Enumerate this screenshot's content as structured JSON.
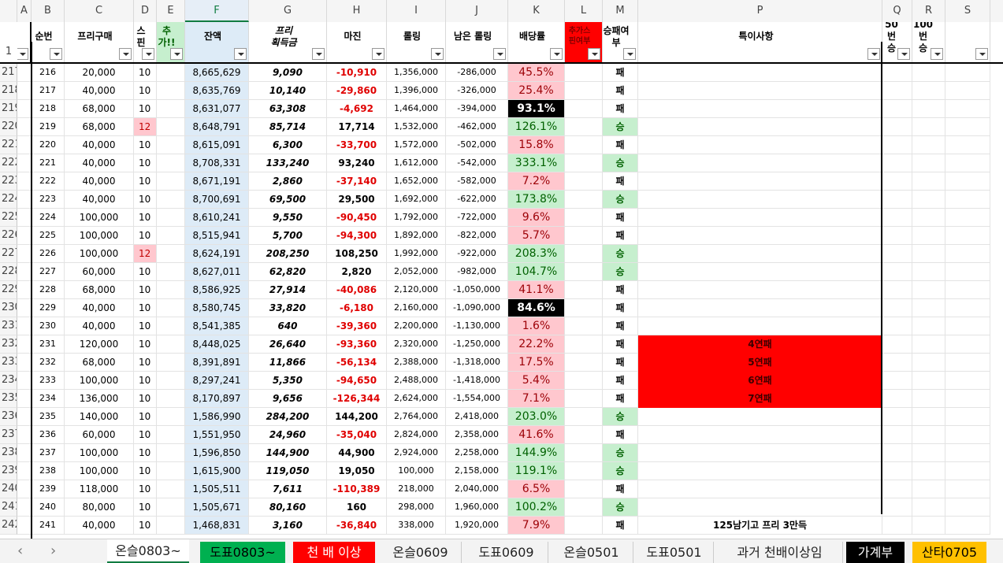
{
  "colors": {
    "pink": "#ffc7ce",
    "green_fill": "#c6efce",
    "green_text": "#006100",
    "red": "#ff0000",
    "blue_col": "#ddebf7",
    "black": "#000000"
  },
  "column_letters": [
    "A",
    "B",
    "C",
    "D",
    "E",
    "F",
    "G",
    "H",
    "I",
    "J",
    "K",
    "L",
    "M",
    "P",
    "Q",
    "R",
    "S"
  ],
  "header_row_number": "1",
  "headers": {
    "B": "순번",
    "C": "프리구매",
    "D": "스핀",
    "E": "추가!!",
    "F": "잔액",
    "G": "프리\n획득금",
    "H": "마진",
    "I": "롤링",
    "J": "남은 롤링",
    "K": "배당률",
    "L": "추가스\n핀여부",
    "M": "승패여\n부",
    "P": "특이사항",
    "Q": "50번\n승",
    "R": "100번\n승"
  },
  "rows": [
    {
      "n": "217",
      "b": "216",
      "c": "20,000",
      "d": "10",
      "f": "8,665,629",
      "g": "9,090",
      "h": "-10,910",
      "i": "1,356,000",
      "j": "-286,000",
      "k": "45.5%",
      "m": "패",
      "p": "",
      "kstyle": "pink"
    },
    {
      "n": "218",
      "b": "217",
      "c": "40,000",
      "d": "10",
      "f": "8,635,769",
      "g": "10,140",
      "h": "-29,860",
      "i": "1,396,000",
      "j": "-326,000",
      "k": "25.4%",
      "m": "패",
      "p": "",
      "kstyle": "pink"
    },
    {
      "n": "219",
      "b": "218",
      "c": "68,000",
      "d": "10",
      "f": "8,631,077",
      "g": "63,308",
      "h": "-4,692",
      "i": "1,464,000",
      "j": "-394,000",
      "k": "93.1%",
      "m": "패",
      "p": "",
      "kstyle": "black"
    },
    {
      "n": "220",
      "b": "219",
      "c": "68,000",
      "d": "12",
      "f": "8,648,791",
      "g": "85,714",
      "h": "17,714",
      "i": "1,532,000",
      "j": "-462,000",
      "k": "126.1%",
      "m": "승",
      "p": "",
      "kstyle": "green",
      "dpink": true
    },
    {
      "n": "221",
      "b": "220",
      "c": "40,000",
      "d": "10",
      "f": "8,615,091",
      "g": "6,300",
      "h": "-33,700",
      "i": "1,572,000",
      "j": "-502,000",
      "k": "15.8%",
      "m": "패",
      "p": "",
      "kstyle": "pink"
    },
    {
      "n": "222",
      "b": "221",
      "c": "40,000",
      "d": "10",
      "f": "8,708,331",
      "g": "133,240",
      "h": "93,240",
      "i": "1,612,000",
      "j": "-542,000",
      "k": "333.1%",
      "m": "승",
      "p": "",
      "kstyle": "green"
    },
    {
      "n": "223",
      "b": "222",
      "c": "40,000",
      "d": "10",
      "f": "8,671,191",
      "g": "2,860",
      "h": "-37,140",
      "i": "1,652,000",
      "j": "-582,000",
      "k": "7.2%",
      "m": "패",
      "p": "",
      "kstyle": "pink"
    },
    {
      "n": "224",
      "b": "223",
      "c": "40,000",
      "d": "10",
      "f": "8,700,691",
      "g": "69,500",
      "h": "29,500",
      "i": "1,692,000",
      "j": "-622,000",
      "k": "173.8%",
      "m": "승",
      "p": "",
      "kstyle": "green"
    },
    {
      "n": "225",
      "b": "224",
      "c": "100,000",
      "d": "10",
      "f": "8,610,241",
      "g": "9,550",
      "h": "-90,450",
      "i": "1,792,000",
      "j": "-722,000",
      "k": "9.6%",
      "m": "패",
      "p": "",
      "kstyle": "pink"
    },
    {
      "n": "226",
      "b": "225",
      "c": "100,000",
      "d": "10",
      "f": "8,515,941",
      "g": "5,700",
      "h": "-94,300",
      "i": "1,892,000",
      "j": "-822,000",
      "k": "5.7%",
      "m": "패",
      "p": "",
      "kstyle": "pink"
    },
    {
      "n": "227",
      "b": "226",
      "c": "100,000",
      "d": "12",
      "f": "8,624,191",
      "g": "208,250",
      "h": "108,250",
      "i": "1,992,000",
      "j": "-922,000",
      "k": "208.3%",
      "m": "승",
      "p": "",
      "kstyle": "green",
      "dpink": true
    },
    {
      "n": "228",
      "b": "227",
      "c": "60,000",
      "d": "10",
      "f": "8,627,011",
      "g": "62,820",
      "h": "2,820",
      "i": "2,052,000",
      "j": "-982,000",
      "k": "104.7%",
      "m": "승",
      "p": "",
      "kstyle": "green"
    },
    {
      "n": "229",
      "b": "228",
      "c": "68,000",
      "d": "10",
      "f": "8,586,925",
      "g": "27,914",
      "h": "-40,086",
      "i": "2,120,000",
      "j": "-1,050,000",
      "k": "41.1%",
      "m": "패",
      "p": "",
      "kstyle": "pink"
    },
    {
      "n": "230",
      "b": "229",
      "c": "40,000",
      "d": "10",
      "f": "8,580,745",
      "g": "33,820",
      "h": "-6,180",
      "i": "2,160,000",
      "j": "-1,090,000",
      "k": "84.6%",
      "m": "패",
      "p": "",
      "kstyle": "black"
    },
    {
      "n": "231",
      "b": "230",
      "c": "40,000",
      "d": "10",
      "f": "8,541,385",
      "g": "640",
      "h": "-39,360",
      "i": "2,200,000",
      "j": "-1,130,000",
      "k": "1.6%",
      "m": "패",
      "p": "",
      "kstyle": "pink"
    },
    {
      "n": "232",
      "b": "231",
      "c": "120,000",
      "d": "10",
      "f": "8,448,025",
      "g": "26,640",
      "h": "-93,360",
      "i": "2,320,000",
      "j": "-1,250,000",
      "k": "22.2%",
      "m": "패",
      "p": "4연패",
      "kstyle": "pink",
      "pred": true
    },
    {
      "n": "233",
      "b": "232",
      "c": "68,000",
      "d": "10",
      "f": "8,391,891",
      "g": "11,866",
      "h": "-56,134",
      "i": "2,388,000",
      "j": "-1,318,000",
      "k": "17.5%",
      "m": "패",
      "p": "5연패",
      "kstyle": "pink",
      "pred": true
    },
    {
      "n": "234",
      "b": "233",
      "c": "100,000",
      "d": "10",
      "f": "8,297,241",
      "g": "5,350",
      "h": "-94,650",
      "i": "2,488,000",
      "j": "-1,418,000",
      "k": "5.4%",
      "m": "패",
      "p": "6연패",
      "kstyle": "pink",
      "pred": true
    },
    {
      "n": "235",
      "b": "234",
      "c": "136,000",
      "d": "10",
      "f": "8,170,897",
      "g": "9,656",
      "h": "-126,344",
      "i": "2,624,000",
      "j": "-1,554,000",
      "k": "7.1%",
      "m": "패",
      "p": "7연패",
      "kstyle": "pink",
      "pred": true
    },
    {
      "n": "236",
      "b": "235",
      "c": "140,000",
      "d": "10",
      "f": "1,586,990",
      "g": "284,200",
      "h": "144,200",
      "i": "2,764,000",
      "j": "2,418,000",
      "k": "203.0%",
      "m": "승",
      "p": "",
      "kstyle": "green"
    },
    {
      "n": "237",
      "b": "236",
      "c": "60,000",
      "d": "10",
      "f": "1,551,950",
      "g": "24,960",
      "h": "-35,040",
      "i": "2,824,000",
      "j": "2,358,000",
      "k": "41.6%",
      "m": "패",
      "p": "",
      "kstyle": "pink"
    },
    {
      "n": "238",
      "b": "237",
      "c": "100,000",
      "d": "10",
      "f": "1,596,850",
      "g": "144,900",
      "h": "44,900",
      "i": "2,924,000",
      "j": "2,258,000",
      "k": "144.9%",
      "m": "승",
      "p": "",
      "kstyle": "green"
    },
    {
      "n": "239",
      "b": "238",
      "c": "100,000",
      "d": "10",
      "f": "1,615,900",
      "g": "119,050",
      "h": "19,050",
      "i": "100,000",
      "j": "2,158,000",
      "k": "119.1%",
      "m": "승",
      "p": "",
      "kstyle": "green"
    },
    {
      "n": "240",
      "b": "239",
      "c": "118,000",
      "d": "10",
      "f": "1,505,511",
      "g": "7,611",
      "h": "-110,389",
      "i": "218,000",
      "j": "2,040,000",
      "k": "6.5%",
      "m": "패",
      "p": "",
      "kstyle": "pink"
    },
    {
      "n": "241",
      "b": "240",
      "c": "80,000",
      "d": "10",
      "f": "1,505,671",
      "g": "80,160",
      "h": "160",
      "i": "298,000",
      "j": "1,960,000",
      "k": "100.2%",
      "m": "승",
      "p": "",
      "kstyle": "green"
    },
    {
      "n": "242",
      "b": "241",
      "c": "40,000",
      "d": "10",
      "f": "1,468,831",
      "g": "3,160",
      "h": "-36,840",
      "i": "338,000",
      "j": "1,920,000",
      "k": "7.9%",
      "m": "패",
      "p": "125남기고 프리 3만득",
      "kstyle": "pink"
    }
  ],
  "sheet_tabs": [
    {
      "label": "온슬0803~",
      "style": "active"
    },
    {
      "label": "도표0803~",
      "style": "green"
    },
    {
      "label": "천 배 이상",
      "style": "red"
    },
    {
      "label": "온슬0609",
      "style": "plain"
    },
    {
      "label": "도표0609",
      "style": "plain"
    },
    {
      "label": "온슬0501",
      "style": "plain"
    },
    {
      "label": "도표0501",
      "style": "plain"
    },
    {
      "label": "과거 천배이상임",
      "style": "plain"
    },
    {
      "label": "가계부",
      "style": "black"
    },
    {
      "label": "산타0705",
      "style": "yellow"
    }
  ],
  "nav": {
    "prev": "‹",
    "next": "›"
  }
}
